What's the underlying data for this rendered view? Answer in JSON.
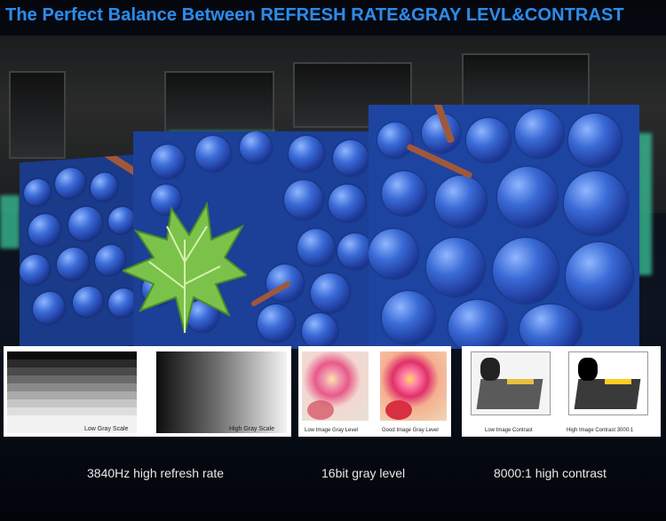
{
  "headline": "The Perfect Balance Between REFRESH RATE&GRAY LEVL&CONTRAST",
  "comparisons": {
    "gray_scale": {
      "low_label": "Low Gray Scale",
      "high_label": "High Gray Scale"
    },
    "gray_level": {
      "low_label": "Low Image Gray Level",
      "good_label": "Good Image Gray Level"
    },
    "contrast": {
      "low_label": "Low Image Contrast",
      "high_label": "High Image Contrast 3000:1"
    }
  },
  "features": {
    "refresh": "3840Hz high refresh rate",
    "gray": "16bit gray level",
    "contrast": "8000:1 high contrast"
  },
  "colors": {
    "headline": "#2e8be6",
    "led_blue": "#1e44a0",
    "leaf_green": "#7bc24a"
  }
}
